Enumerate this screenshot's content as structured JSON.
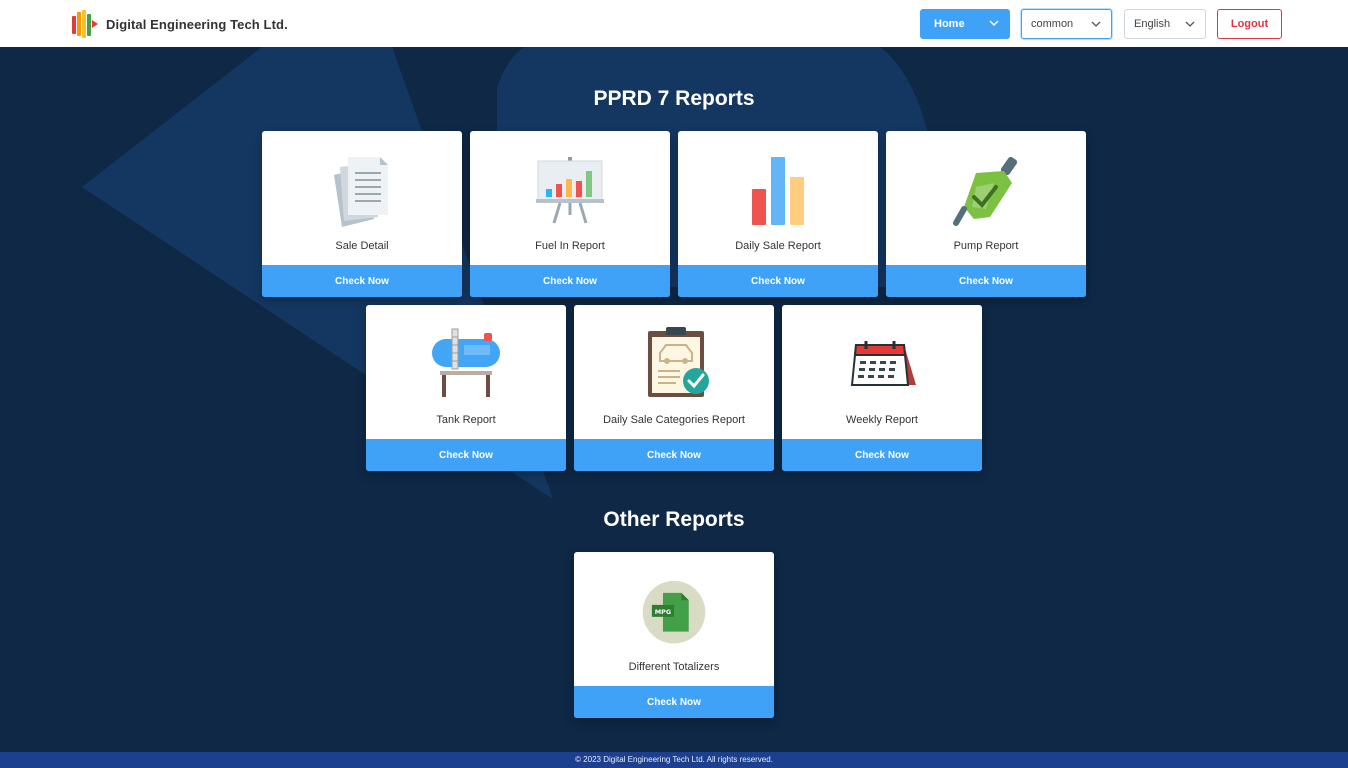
{
  "header": {
    "brand_name": "Digital Engineering Tech Ltd.",
    "home_label": "Home",
    "station_select": "common",
    "language_select": "English",
    "logout_label": "Logout"
  },
  "sections": {
    "pprd_title": "PPRD 7 Reports",
    "other_title": "Other Reports"
  },
  "cards": {
    "sale_detail": {
      "label": "Sale Detail",
      "button": "Check Now",
      "icon": "documents-icon"
    },
    "fuel_in": {
      "label": "Fuel In Report",
      "button": "Check Now",
      "icon": "presentation-chart-icon"
    },
    "daily_sale": {
      "label": "Daily Sale Report",
      "button": "Check Now",
      "icon": "bar-chart-icon"
    },
    "pump": {
      "label": "Pump Report",
      "button": "Check Now",
      "icon": "fuel-nozzle-icon"
    },
    "tank": {
      "label": "Tank Report",
      "button": "Check Now",
      "icon": "tank-icon"
    },
    "daily_sale_categories": {
      "label": "Daily Sale Categories Report",
      "button": "Check Now",
      "icon": "clipboard-car-icon"
    },
    "weekly": {
      "label": "Weekly Report",
      "button": "Check Now",
      "icon": "calendar-icon"
    },
    "different_totalizers": {
      "label": "Different Totalizers",
      "button": "Check Now",
      "icon": "mpg-file-icon",
      "icon_text": "MPG"
    }
  },
  "footer": {
    "copyright": "© 2023 Digital Engineering Tech Ltd. All rights reserved."
  },
  "colors": {
    "background": "#0f2846",
    "accent": "#3fa2f7",
    "logout": "#dc3545",
    "footer": "#1d3f8f"
  }
}
